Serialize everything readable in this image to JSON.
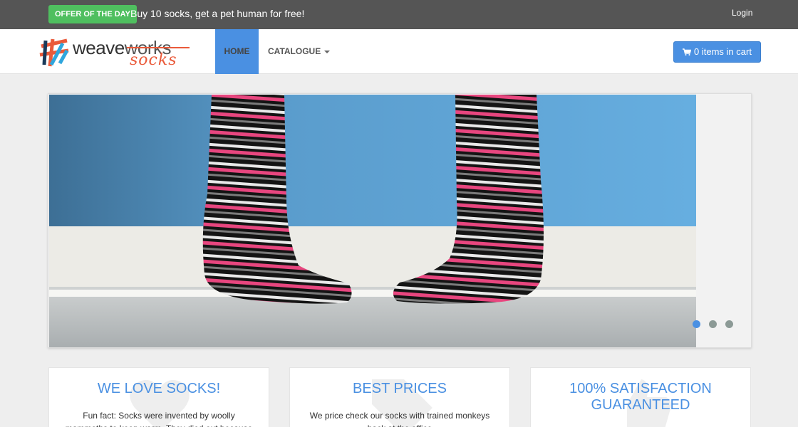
{
  "topbar": {
    "offer_badge": "OFFER OF THE DAY",
    "offer_text": "Buy 10 socks, get a pet human for free!",
    "login": "Login"
  },
  "brand": {
    "logo_main": "weave",
    "logo_works": "works",
    "logo_sub": "socks"
  },
  "nav": {
    "home": "HOME",
    "catalogue": "CATALOGUE",
    "cart": "0 items in cart"
  },
  "carousel": {
    "slide_count": 3,
    "active_slide": 1
  },
  "features": [
    {
      "title": "WE LOVE SOCKS!",
      "text": "Fun fact: Socks were invented by woolly mammoths to keep warm. They died out because"
    },
    {
      "title": "BEST PRICES",
      "text": "We price check our socks with trained monkeys back at the office"
    },
    {
      "title_line1": "100% SATISFACTION",
      "title_line2": "GUARANTEED"
    }
  ],
  "colors": {
    "accent": "#4a90e2",
    "offer_green": "#4fbf5f",
    "topbar": "#555555",
    "brand_orange": "#ea5a3a"
  }
}
